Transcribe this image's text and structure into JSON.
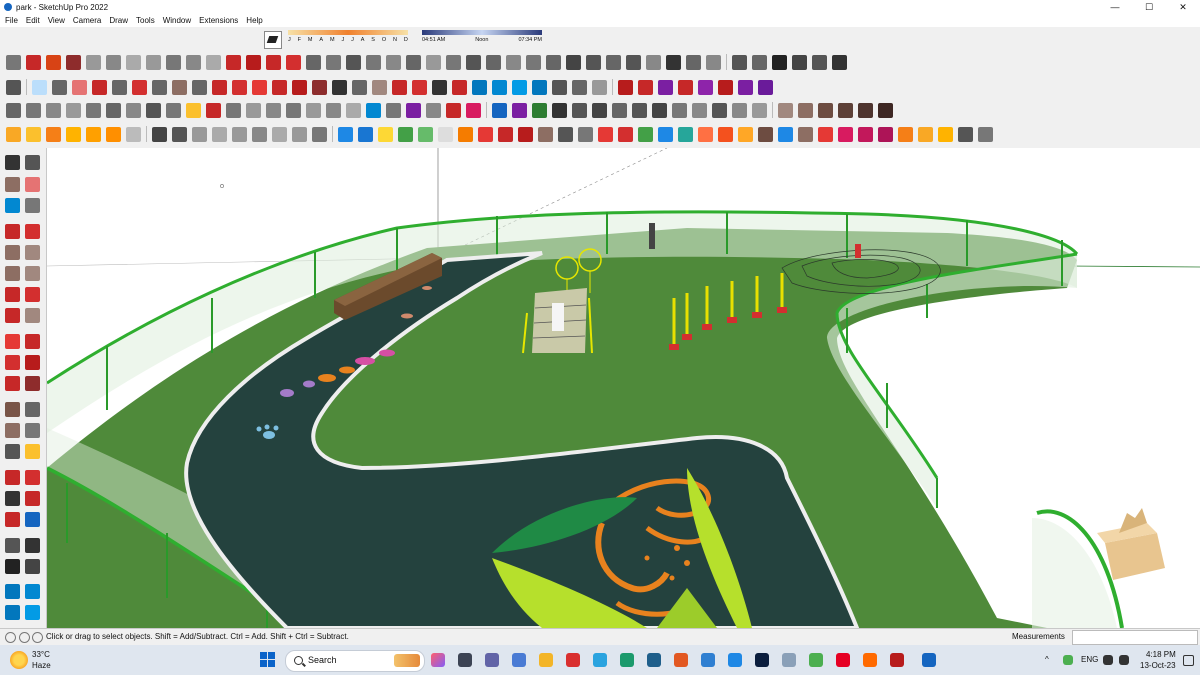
{
  "window": {
    "title": "park - SketchUp Pro 2022",
    "controls": {
      "minimize": "—",
      "maximize": "☐",
      "close": "✕"
    }
  },
  "menubar": {
    "items": [
      "File",
      "Edit",
      "View",
      "Camera",
      "Draw",
      "Tools",
      "Window",
      "Extensions",
      "Help"
    ]
  },
  "shadow_settings": {
    "months": [
      "J",
      "F",
      "M",
      "A",
      "M",
      "J",
      "J",
      "A",
      "S",
      "O",
      "N",
      "D"
    ],
    "sunrise": "04:51 AM",
    "noon": "Noon",
    "sunset": "07:34 PM"
  },
  "colors": {
    "grass": "#4f8a3a",
    "path": "#24423e",
    "fence": "#2fae2f",
    "lime": "#b6e02c",
    "orange": "#e8821e",
    "wood": "#6b4a2c"
  },
  "status": {
    "hint": "Click or drag to select objects. Shift = Add/Subtract. Ctrl = Add. Shift + Ctrl = Subtract.",
    "measurements_label": "Measurements"
  },
  "taskbar": {
    "weather_temp": "33°C",
    "weather_desc": "Haze",
    "search_label": "Search",
    "tray_chevron": "^",
    "tray_lang": "ENG",
    "time": "4:18 PM",
    "date": "13-Oct-23"
  }
}
